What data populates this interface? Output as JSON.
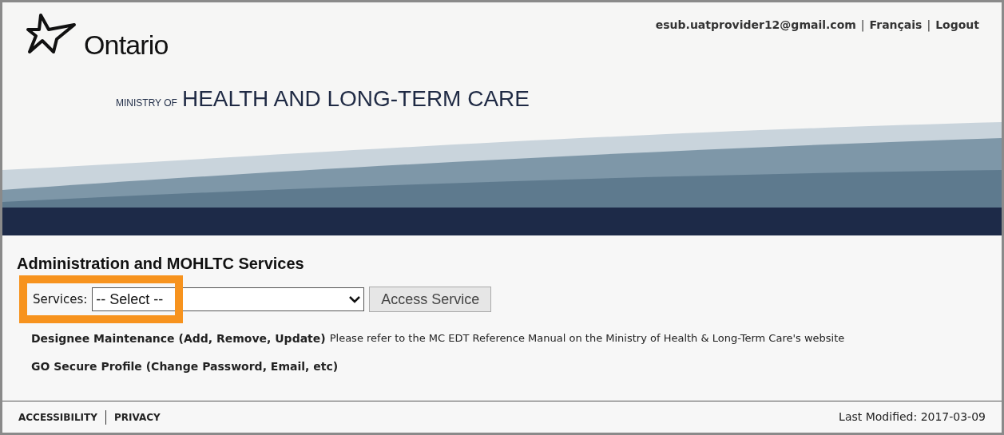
{
  "header": {
    "logo_text": "Ontario",
    "ministry_prefix": "MINISTRY OF",
    "ministry_name": "HEALTH AND LONG-TERM CARE",
    "user_bar": [
      {
        "kind": "link",
        "text": "esub.uatprovider12@gmail.com"
      },
      {
        "kind": "separator",
        "text": "|"
      },
      {
        "kind": "link",
        "text": "Français"
      },
      {
        "kind": "separator",
        "text": "|"
      },
      {
        "kind": "link",
        "text": "Logout"
      }
    ]
  },
  "main": {
    "heading": "Administration and MOHLTC Services",
    "services_label": "Services:",
    "services_select": {
      "value": "-- Select --"
    },
    "access_button": "Access Service",
    "annotation": {
      "kind": "highlight"
    },
    "links": [
      {
        "text": "Designee Maintenance (Add, Remove, Update)",
        "note": "Please refer to the MC EDT Reference Manual on the Ministry of Health & Long-Term Care's website"
      },
      {
        "text": "GO Secure Profile (Change Password, Email, etc)"
      }
    ]
  },
  "footer": {
    "links": [
      "ACCESSIBILITY",
      "PRIVACY"
    ],
    "last_modified": "Last Modified: 2017-03-09"
  }
}
